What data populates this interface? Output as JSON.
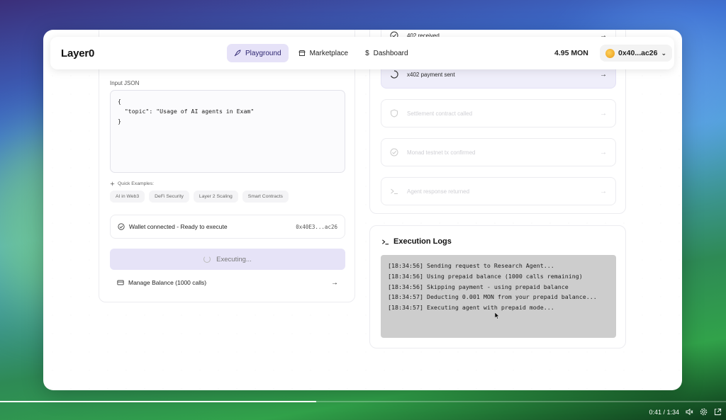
{
  "app": {
    "logo": "Layer0"
  },
  "nav": {
    "items": [
      {
        "label": "Playground",
        "icon": "rocket-icon",
        "active": true
      },
      {
        "label": "Marketplace",
        "icon": "store-icon",
        "active": false
      },
      {
        "label": "Dashboard",
        "icon": "dollar-icon",
        "active": false
      }
    ],
    "balance": "4.95 MON",
    "wallet_short": "0x40...ac26"
  },
  "input": {
    "label": "Input JSON",
    "json": "{\n  \"topic\": \"Usage of AI agents in Exam\"\n}",
    "quick_label": "Quick Examples:",
    "chips": [
      "AI in Web3",
      "DeFi Security",
      "Layer 2 Scaling",
      "Smart Contracts"
    ],
    "wallet_status": "Wallet connected - Ready to execute",
    "wallet_addr": "0x40E3...ac26",
    "execute_label": "Executing...",
    "manage_label": "Manage Balance (1000 calls)"
  },
  "steps": [
    {
      "label": "402 received",
      "state": "done"
    },
    {
      "label": "x402 payment sent",
      "state": "current"
    },
    {
      "label": "Settlement contract called",
      "state": "pending"
    },
    {
      "label": "Monad testnet tx confirmed",
      "state": "pending"
    },
    {
      "label": "Agent response returned",
      "state": "pending"
    }
  ],
  "logs": {
    "title": "Execution Logs",
    "lines": [
      "[18:34:56] Sending request to Research Agent...",
      "[18:34:56] Using prepaid balance (1000 calls remaining)",
      "[18:34:56] Skipping payment - using prepaid balance",
      "[18:34:57] Deducting 0.001 MON from your prepaid balance...",
      "[18:34:57] Executing agent with prepaid mode..."
    ]
  },
  "video": {
    "time": "0:41 / 1:34",
    "progress": 0.436
  },
  "colors": {
    "accent": "#e6e2f8",
    "accent_text": "#2c2470",
    "log_bg": "#cdcdcd"
  }
}
